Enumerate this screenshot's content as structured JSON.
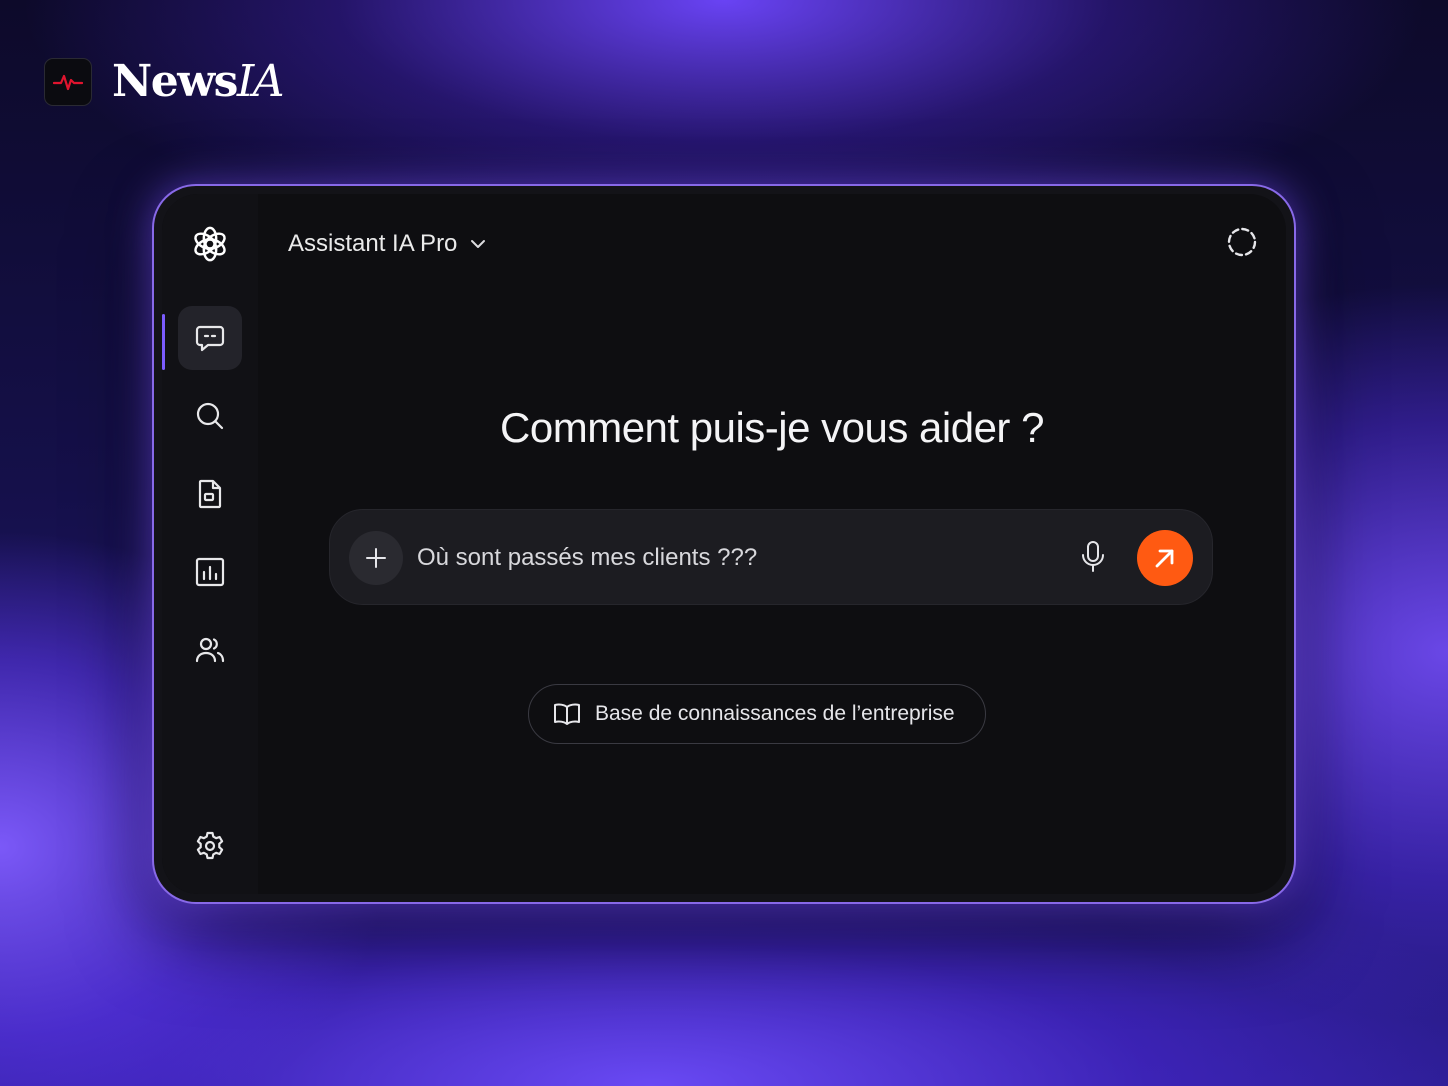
{
  "brand": {
    "name_bold": "News",
    "name_italic": "IA",
    "badge_icon": "pulse-icon",
    "badge_color": "#e0142e"
  },
  "window": {
    "accent_border": "#9673ff"
  },
  "sidebar": {
    "logo_icon": "openai-logo-icon",
    "items": [
      {
        "icon": "chat-icon",
        "active": true
      },
      {
        "icon": "search-icon",
        "active": false
      },
      {
        "icon": "document-icon",
        "active": false
      },
      {
        "icon": "chart-icon",
        "active": false
      },
      {
        "icon": "users-icon",
        "active": false
      }
    ],
    "settings_icon": "gear-icon"
  },
  "header": {
    "model_name": "Assistant IA Pro",
    "model_dropdown_icon": "chevron-down-icon",
    "top_right_icon": "dashed-circle-icon"
  },
  "main": {
    "headline": "Comment puis-je vous aider ?",
    "prompt": {
      "value": "Où sont passés mes clients ???",
      "add_icon": "plus-icon",
      "mic_icon": "microphone-icon",
      "send_icon": "arrow-up-right-icon",
      "send_color": "#ff5a12"
    },
    "knowledge_chip": {
      "label": "Base de connaissances de l’entreprise",
      "icon": "book-icon"
    }
  }
}
